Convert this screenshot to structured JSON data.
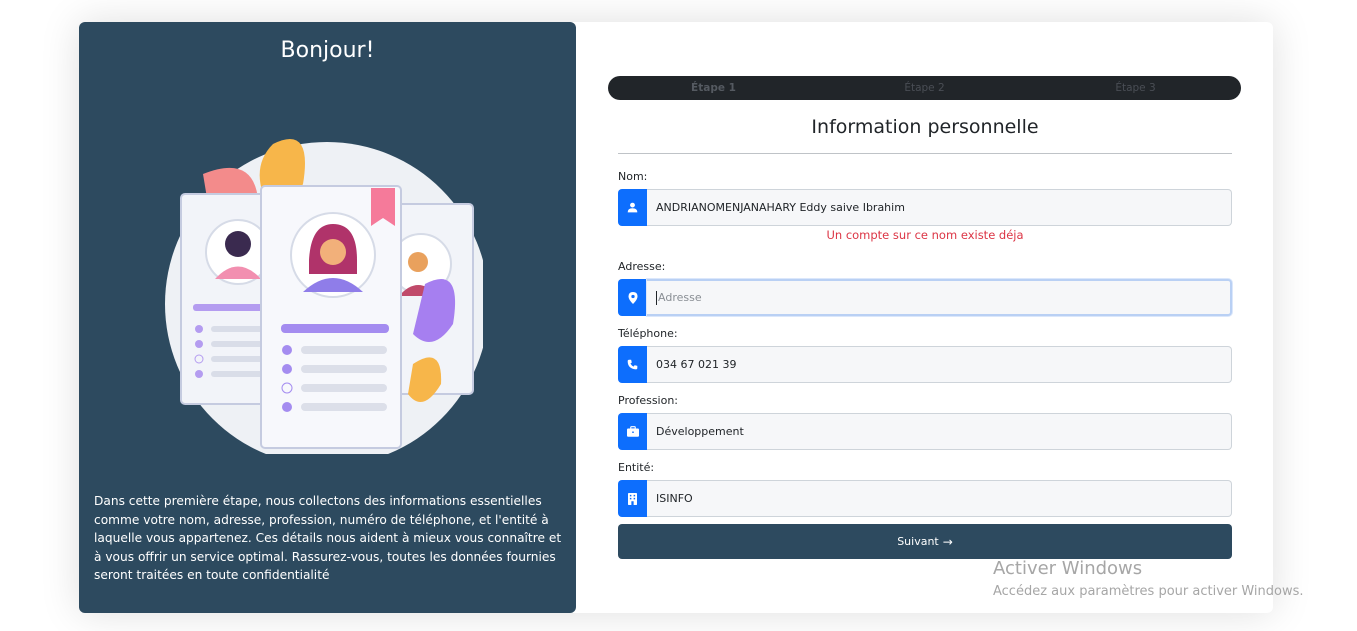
{
  "left_panel": {
    "title": "Bonjour!",
    "description": "Dans cette première étape, nous collectons des informations essentielles comme votre nom, adresse, profession, numéro de téléphone, et l'entité à laquelle vous appartenez. Ces détails nous aident à mieux vous connaître et à vous offrir un service optimal. Rassurez-vous, toutes les données fournies seront traitées en toute confidentialité"
  },
  "steps": [
    {
      "label": "Étape 1",
      "active": true
    },
    {
      "label": "Étape 2",
      "active": false
    },
    {
      "label": "Étape 3",
      "active": false
    }
  ],
  "form": {
    "title": "Information personnelle",
    "nom": {
      "label": "Nom:",
      "value": "ANDRIANOMENJANAHARY Eddy saive Ibrahim",
      "icon": "user-icon"
    },
    "nom_error": "Un compte sur ce nom existe déja",
    "adresse": {
      "label": "Adresse:",
      "value": "",
      "placeholder": "Adresse",
      "icon": "map-pin-icon"
    },
    "telephone": {
      "label": "Téléphone:",
      "value": "034 67 021 39",
      "icon": "phone-icon"
    },
    "profession": {
      "label": "Profession:",
      "value": "Développement",
      "icon": "briefcase-icon"
    },
    "entite": {
      "label": "Entité:",
      "value": "ISINFO",
      "icon": "building-icon"
    },
    "submit_label": "Suivant",
    "submit_icon": "arrow-right-icon"
  },
  "watermark": {
    "line1": "Activer Windows",
    "line2": "Accédez aux paramètres pour activer Windows."
  },
  "colors": {
    "panel": "#2d4a5f",
    "accent": "#0d6efd",
    "error": "#dc3545",
    "steps_bar": "#212529"
  }
}
